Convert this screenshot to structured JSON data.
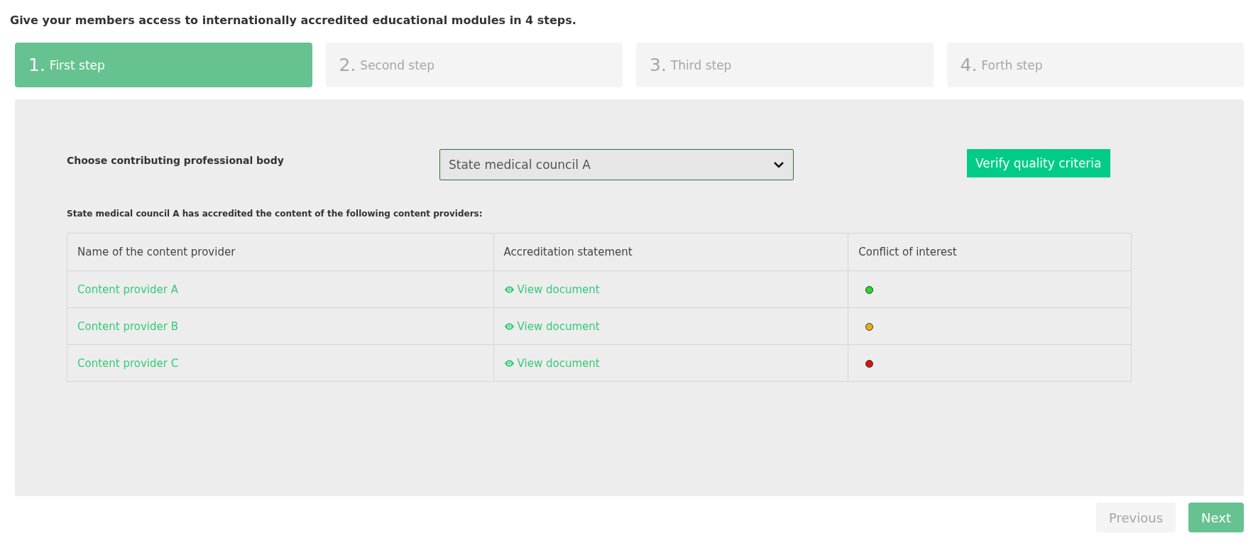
{
  "heading": "Give your members access to internationally accredited educational modules in 4 steps.",
  "steps": [
    {
      "number": "1.",
      "label": "First step",
      "selected": true
    },
    {
      "number": "2.",
      "label": "Second step",
      "selected": false
    },
    {
      "number": "3.",
      "label": "Third step",
      "selected": false
    },
    {
      "number": "4.",
      "label": "Forth step",
      "selected": false
    }
  ],
  "body_label": "Choose contributing professional body",
  "body_select": {
    "value": "State medical council A"
  },
  "verify_button": "Verify quality criteria",
  "note": "State medical council A has accredited the content of the following content providers:",
  "table": {
    "columns": [
      "Name of the content provider",
      "Accreditation statement",
      "Conflict of interest"
    ],
    "rows": [
      {
        "provider": "Content provider A",
        "statement": "View document",
        "color": "#22dd22"
      },
      {
        "provider": "Content provider B",
        "statement": "View document",
        "color": "#e6b012"
      },
      {
        "provider": "Content provider C",
        "statement": "View document",
        "color": "#e01010"
      }
    ]
  },
  "nav": [
    {
      "label": "Previous",
      "disabled": true
    },
    {
      "label": "Next",
      "disabled": false
    }
  ]
}
